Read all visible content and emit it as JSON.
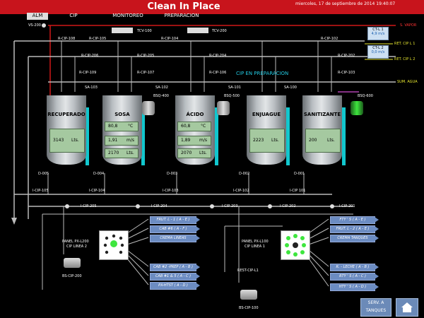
{
  "header": {
    "title": "Clean In Place",
    "datetime": "miercoles, 17 de septiembre de 2014  19:40:07"
  },
  "menu": {
    "items": [
      "ALM",
      "CIP",
      "MONITOREO",
      "PREPARACION"
    ]
  },
  "labels": {
    "valves": [
      "VS-200",
      "R-CIP-108",
      "R-CIP-105",
      "TCV-100",
      "R-CIP-104",
      "TCV-200",
      "R-CIP-102",
      "R-CIP-206",
      "R-CIP-205",
      "R-CIP-204",
      "R-CIP-202",
      "R-CIP-109",
      "R-CIP-107",
      "R-CIP-106",
      "R-CIP-103",
      "SA-103",
      "SA-102",
      "SA-101",
      "SA-100",
      "BSQ-400",
      "BSQ-500",
      "BSQ-600"
    ],
    "lines": {
      "vapor": "S. VAPOR",
      "ret1": "RET. CIP L 1",
      "ret2": "RET. CIP L 2",
      "agua": "SUM. AGUA"
    },
    "legend_boxes": [
      {
        "tag": "CT-L 1",
        "value": "4,9 m/s"
      },
      {
        "tag": "CT-L 2",
        "value": "0,0 m/s"
      }
    ],
    "prep": "CIP EN PREPARACION",
    "bottom_valves": [
      "D-005",
      "D-004",
      "D-003",
      "D-002",
      "D-001"
    ],
    "icip_top": [
      "I-CIP-105",
      "I-CIP-104",
      "I-CIP-103",
      "I-CIP-102",
      "I-CIP 101"
    ],
    "icip_row": [
      "I-CIP-205",
      "I-CIP-204",
      "I-CIP-203",
      "I-CIP-202",
      "I-CIP-201"
    ]
  },
  "tanks": [
    {
      "name": "RECUPERADO",
      "lines": [
        "3143",
        "Lts."
      ],
      "small": []
    },
    {
      "name": "SOSA",
      "lines": [],
      "small": [
        [
          "80,8",
          "°C"
        ],
        [
          "1,91",
          "m/s"
        ],
        [
          "2170",
          "Lts."
        ]
      ]
    },
    {
      "name": "ÁCIDO",
      "lines": [],
      "small": [
        [
          "60,8",
          "°C"
        ],
        [
          "1,89",
          "m/s"
        ],
        [
          "2070",
          "Lts."
        ]
      ]
    },
    {
      "name": "ENJUAGUE",
      "lines": [
        "2223",
        "Lts."
      ],
      "small": []
    },
    {
      "name": "SANITIZANTE",
      "lines": [
        "200",
        "Lts."
      ],
      "small": []
    }
  ],
  "panels": {
    "left": {
      "title": "PANEL PX-L200",
      "sub": "CIP LINEA 2",
      "pump": "BS-CIP-200"
    },
    "right": {
      "title": "PANEL PX-L100",
      "sub": "CIP LINEA 1",
      "pump": "BS-CIP-100",
      "rest": "REST-CIP-L1"
    }
  },
  "destinations": {
    "left": [
      "FRUT. L - 1 ( A - E )",
      "CAB #6 ( A - F )",
      "CREMA LINEAS",
      "CAB #2 -PREP ( A - B )",
      "CAB #1 & 5 ( A - C )",
      "PX-HTST ( A - D )"
    ],
    "right": [
      "FTY ' S ( A - E )",
      "FRUT. L - 2 ( A - E )",
      "CREMA TANQUES",
      "R. - LECHE ( A - B )",
      "RTY ' S ( A - C )",
      "HTY ' S ( A - D )"
    ]
  },
  "buttons": {
    "serv": "SERV. A TANQUES",
    "home": "home"
  },
  "colors": {
    "header": "#c8141c",
    "lcd": "#a5c9a0",
    "accent": "#11c7ce",
    "green": "#3ee63e"
  }
}
